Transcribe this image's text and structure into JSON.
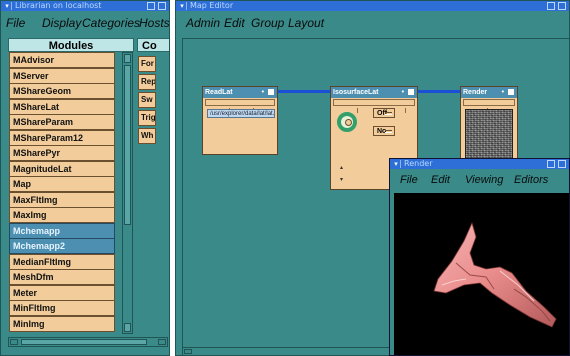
{
  "librarian": {
    "title": "Librarian on localhost",
    "menu": [
      "File",
      "Display",
      "Categories",
      "Hosts"
    ],
    "modules_header": "Modules",
    "categories_header": "Co",
    "modules": [
      {
        "label": "MAdvisor",
        "selected": false
      },
      {
        "label": "MServer",
        "selected": false
      },
      {
        "label": "MShareGeom",
        "selected": false
      },
      {
        "label": "MShareLat",
        "selected": false
      },
      {
        "label": "MShareParam",
        "selected": false
      },
      {
        "label": "MShareParam12",
        "selected": false
      },
      {
        "label": "MSharePyr",
        "selected": false
      },
      {
        "label": "MagnitudeLat",
        "selected": false
      },
      {
        "label": "Map",
        "selected": false
      },
      {
        "label": "MaxFltImg",
        "selected": false
      },
      {
        "label": "MaxImg",
        "selected": false
      },
      {
        "label": "Mchemapp",
        "selected": true
      },
      {
        "label": "Mchemapp2",
        "selected": true
      },
      {
        "label": "MedianFltImg",
        "selected": false
      },
      {
        "label": "MeshDfm",
        "selected": false
      },
      {
        "label": "Meter",
        "selected": false
      },
      {
        "label": "MinFltImg",
        "selected": false
      },
      {
        "label": "MinImg",
        "selected": false
      }
    ],
    "categories": [
      "For",
      "Rep",
      "Sw",
      "Trig",
      "Wh"
    ]
  },
  "map_editor": {
    "title": "Map Editor",
    "menu": [
      "Admin",
      "Edit",
      "Group",
      "Layout"
    ],
    "modules": {
      "readlat": {
        "title": "ReadLat",
        "file": "/usr/explorer/data/lat/lat.ml"
      },
      "isosurface": {
        "title": "IsosurfaceLat",
        "option1": "Off",
        "option2": "No"
      },
      "render": {
        "title": "Render"
      }
    }
  },
  "render_window": {
    "title": "Render",
    "menu": [
      "File",
      "Edit",
      "Viewing",
      "Editors"
    ]
  },
  "colors": {
    "window_bg": "#3a8a8a",
    "titlebar": "#2d6fd6",
    "module_bg": "#f2cc9a",
    "selected_item": "#4c8fb0",
    "wire": "#1b4fd6",
    "surface": "#f29a9a"
  }
}
